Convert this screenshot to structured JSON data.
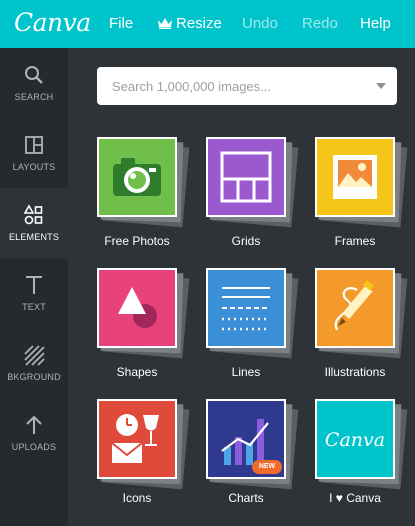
{
  "app": {
    "logo": "Canva"
  },
  "menu": {
    "file": "File",
    "resize": "Resize",
    "undo": "Undo",
    "redo": "Redo",
    "help": "Help"
  },
  "sidebar": {
    "items": [
      {
        "label": "SEARCH",
        "icon": "search-icon"
      },
      {
        "label": "LAYOUTS",
        "icon": "layouts-icon"
      },
      {
        "label": "ELEMENTS",
        "icon": "elements-icon",
        "active": true
      },
      {
        "label": "TEXT",
        "icon": "text-icon"
      },
      {
        "label": "BKGROUND",
        "icon": "background-icon"
      },
      {
        "label": "UPLOADS",
        "icon": "upload-icon"
      }
    ]
  },
  "search": {
    "placeholder": "Search 1,000,000 images..."
  },
  "tiles": [
    {
      "label": "Free Photos",
      "color": "#6fbf4a"
    },
    {
      "label": "Grids",
      "color": "#9b59d0"
    },
    {
      "label": "Frames",
      "color": "#f5c518"
    },
    {
      "label": "Shapes",
      "color": "#e8427c"
    },
    {
      "label": "Lines",
      "color": "#3a8fd6"
    },
    {
      "label": "Illustrations",
      "color": "#f39a2a"
    },
    {
      "label": "Icons",
      "color": "#e04a3a"
    },
    {
      "label": "Charts",
      "color": "#2f3a8f",
      "badge": "NEW"
    },
    {
      "label": "I ♥ Canva",
      "color": "#00c4cc",
      "logo_text": "Canva"
    }
  ],
  "colors": {
    "brand": "#00c4cc",
    "sidebar": "#26292d",
    "panel": "#2e3338"
  }
}
